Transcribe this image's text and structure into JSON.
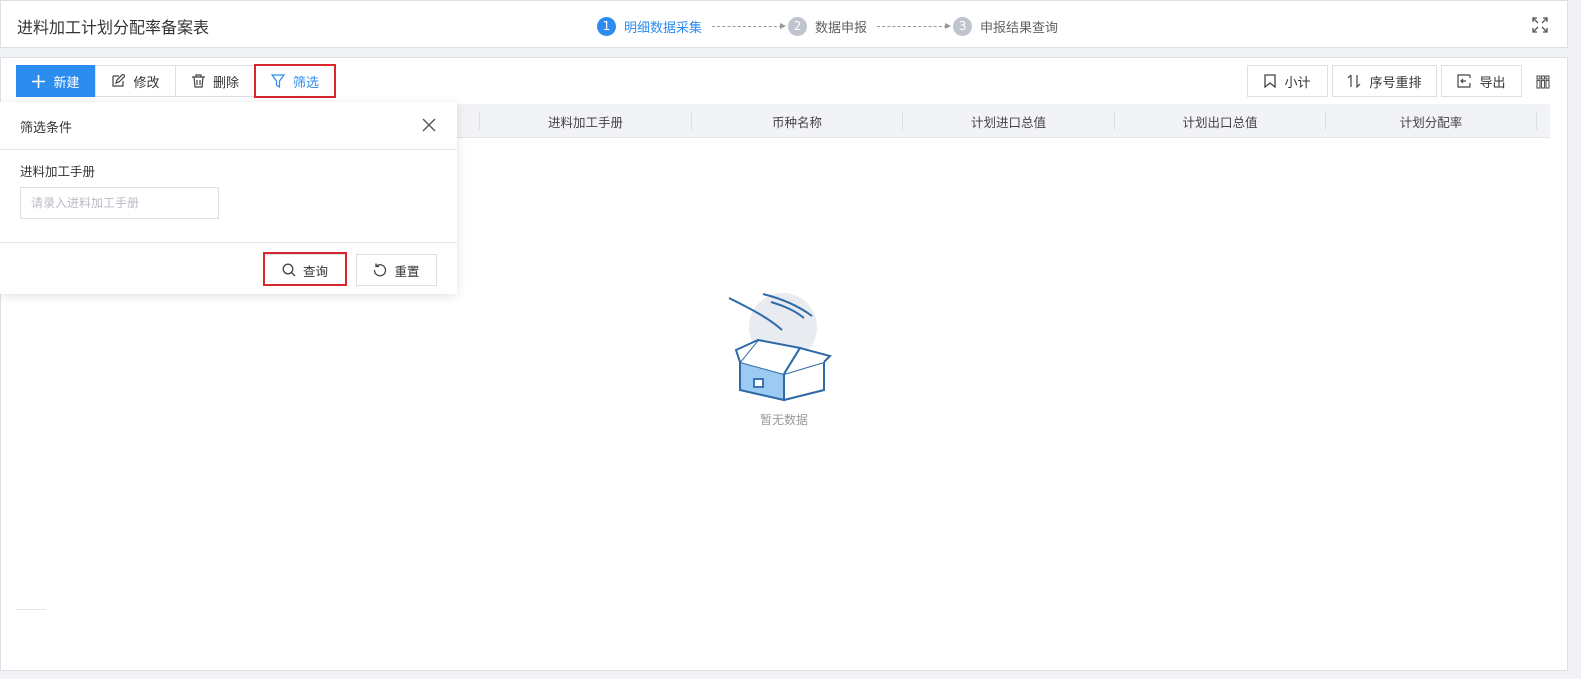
{
  "header": {
    "title": "进料加工计划分配率备案表",
    "steps": [
      {
        "num": "1",
        "label": "明细数据采集",
        "active": true
      },
      {
        "num": "2",
        "label": "数据申报",
        "active": false
      },
      {
        "num": "3",
        "label": "申报结果查询",
        "active": false
      }
    ]
  },
  "toolbar": {
    "new_label": "新建",
    "edit_label": "修改",
    "delete_label": "删除",
    "filter_label": "筛选",
    "subtotal_label": "小计",
    "reorder_label": "序号重排",
    "export_label": "导出"
  },
  "table": {
    "columns": [
      "进料加工手册",
      "币种名称",
      "计划进口总值",
      "计划出口总值",
      "计划分配率"
    ],
    "empty_text": "暂无数据"
  },
  "filter": {
    "title": "筛选条件",
    "field_label": "进料加工手册",
    "field_placeholder": "请录入进料加工手册",
    "field_value": "",
    "query_label": "查询",
    "reset_label": "重置"
  },
  "colors": {
    "primary": "#2d8cf0",
    "highlight": "#d9262c",
    "header_bg": "#f2f3f7"
  }
}
